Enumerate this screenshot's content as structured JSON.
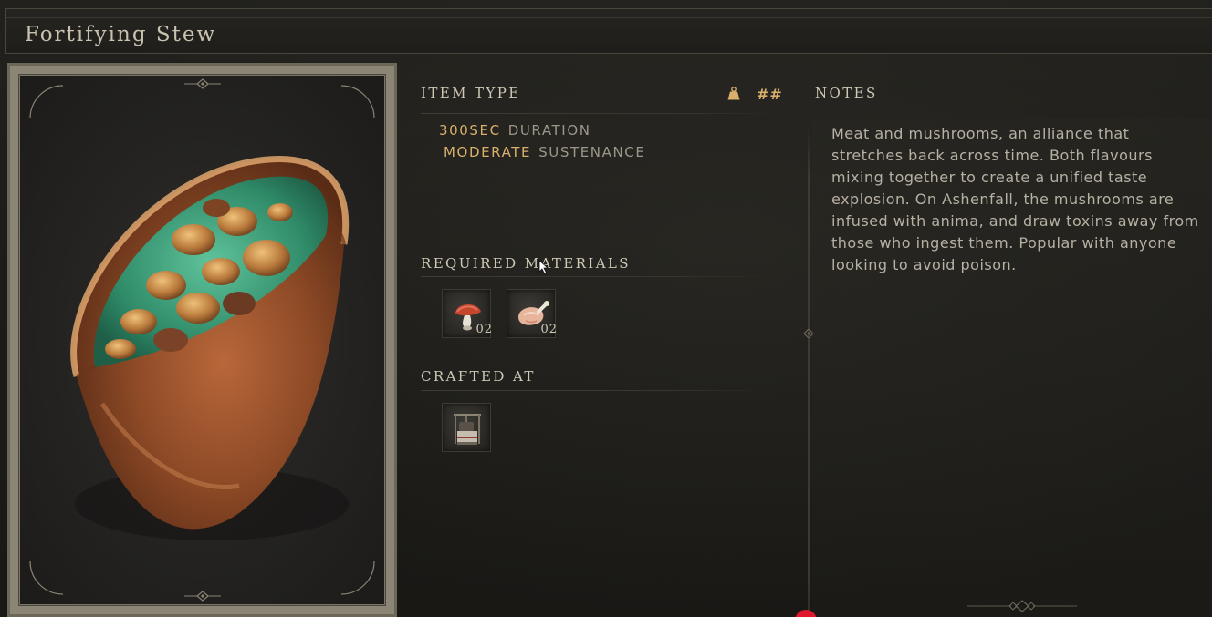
{
  "item": {
    "name": "Fortifying Stew",
    "artwork_icon": "stew-bowl-icon"
  },
  "item_type": {
    "heading": "ITEM TYPE",
    "weight_icon": "weight-icon",
    "weight_value": "##",
    "stats": [
      {
        "value": "300SEC",
        "label": "DURATION"
      },
      {
        "value": "MODERATE",
        "label": "SUSTENANCE"
      }
    ]
  },
  "required_materials": {
    "heading": "REQUIRED MATERIALS",
    "items": [
      {
        "icon": "mushroom-icon",
        "quantity": "02"
      },
      {
        "icon": "raw-meat-icon",
        "quantity": "02"
      }
    ]
  },
  "crafted_at": {
    "heading": "CRAFTED AT",
    "station_icon": "cooking-station-icon"
  },
  "notes": {
    "heading": "NOTES",
    "text": "Meat and mushrooms, an alliance that\nstretches back across time. Both flavours\nmixing together to create a unified taste\nexplosion. On Ashenfall, the mushrooms are\ninfused with anima, and draw toxins away from\nthose who ingest them. Popular with anyone\nlooking to avoid poison."
  },
  "colors": {
    "accent_gold": "#d8b06b",
    "heading_text": "#cfc8b6",
    "body_text": "#b7b1a4",
    "background": "#1c1b18",
    "marker_red": "#e0182d"
  }
}
